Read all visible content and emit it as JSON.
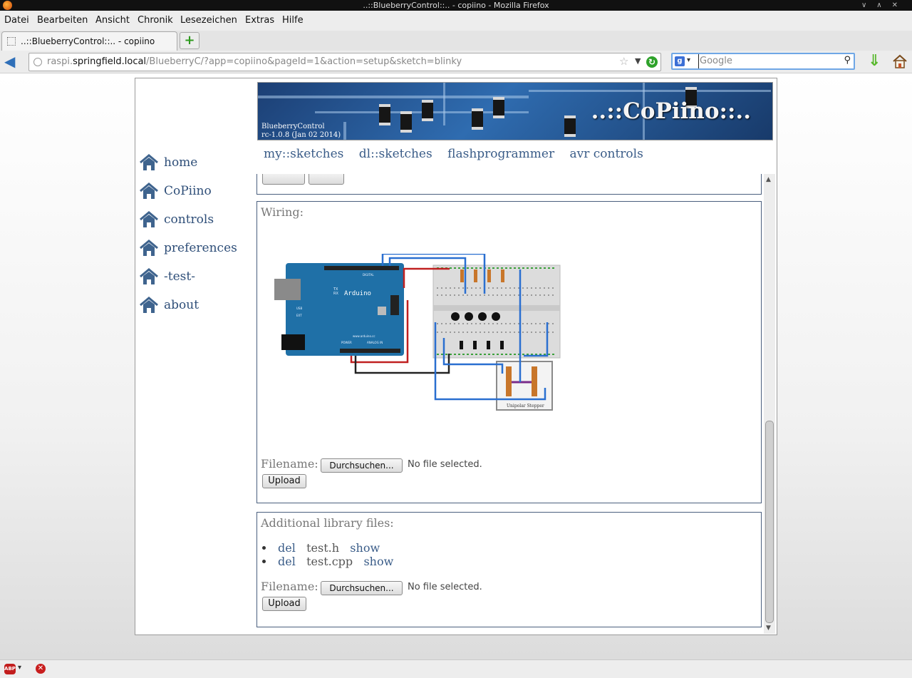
{
  "window": {
    "title": "..::BlueberryControl::.. - copiino - Mozilla Firefox"
  },
  "menu": [
    "Datei",
    "Bearbeiten",
    "Ansicht",
    "Chronik",
    "Lesezeichen",
    "Extras",
    "Hilfe"
  ],
  "tab": {
    "label": "..::BlueberryControl::.. - copiino",
    "new_tab_symbol": "+"
  },
  "urlbar": {
    "prefix": "raspi.",
    "domain": "springfield.local",
    "path": "/BlueberryC/?app=copiino&pageId=1&action=setup&sketch=blinky"
  },
  "search": {
    "engine_letter": "g",
    "placeholder": "Google"
  },
  "sidenav": {
    "items": [
      "home",
      "CoPiino",
      "controls",
      "preferences",
      "-test-",
      "about"
    ],
    "icon": "home-icon"
  },
  "banner": {
    "title": "..::CoPiino::..",
    "app_name": "BlueberryControl",
    "version": "rc-1.0.8 (Jan 02 2014)"
  },
  "topnav": {
    "items": [
      "my::sketches",
      "dl::sketches",
      "flashprogrammer",
      "avr controls"
    ]
  },
  "wiring": {
    "label": "Wiring:",
    "image": {
      "board_name": "Arduino",
      "board_url": "www.arduino.cc",
      "stepper_label": "Unipolar Stepper",
      "tx_label": "TX",
      "rx_label": "RX",
      "digital_label": "DIGITAL",
      "analog_label": "ANALOG IN",
      "power_label": "POWER",
      "ext_label": "EXT",
      "usb_label": "USB"
    },
    "filename_label": "Filename:",
    "browse_label": "Durchsuchen...",
    "nofile_text": "No file selected.",
    "upload_label": "Upload"
  },
  "library": {
    "label": "Additional library files:",
    "files": [
      {
        "del": "del",
        "name": "test.h",
        "show": "show"
      },
      {
        "del": "del",
        "name": "test.cpp",
        "show": "show"
      }
    ],
    "filename_label": "Filename:",
    "browse_label": "Durchsuchen...",
    "nofile_text": "No file selected.",
    "upload_label": "Upload"
  },
  "statusbar": {
    "abp_label": "ABP"
  },
  "colors": {
    "link": "#3a5c88",
    "box_border": "#4a5f7e",
    "board": "#1f70a7",
    "wire_blue": "#2a6fd0",
    "wire_red": "#c02020"
  }
}
